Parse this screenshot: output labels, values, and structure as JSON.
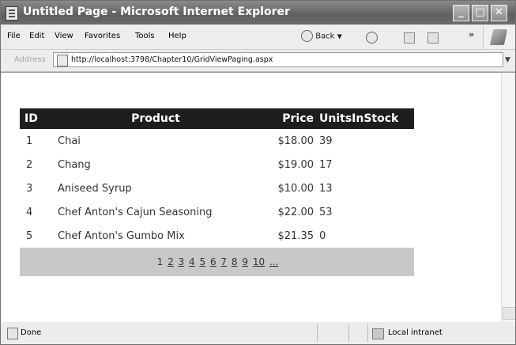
{
  "window": {
    "title": "Untitled Page - Microsoft Internet Explorer"
  },
  "menu": {
    "items": [
      "File",
      "Edit",
      "View",
      "Favorites",
      "Tools",
      "Help"
    ],
    "back_label": "Back"
  },
  "address": {
    "label": "Address",
    "url": "http://localhost:3798/Chapter10/GridViewPaging.aspx"
  },
  "grid": {
    "columns": [
      "ID",
      "Product",
      "Price",
      "UnitsInStock"
    ],
    "rows": [
      {
        "id": "1",
        "product": "Chai",
        "price": "$18.00",
        "units": "39"
      },
      {
        "id": "2",
        "product": "Chang",
        "price": "$19.00",
        "units": "17"
      },
      {
        "id": "3",
        "product": "Aniseed Syrup",
        "price": "$10.00",
        "units": "13"
      },
      {
        "id": "4",
        "product": "Chef Anton's Cajun Seasoning",
        "price": "$22.00",
        "units": "53"
      },
      {
        "id": "5",
        "product": "Chef Anton's Gumbo Mix",
        "price": "$21.35",
        "units": "0"
      }
    ],
    "pager": [
      "1",
      "2",
      "3",
      "4",
      "5",
      "6",
      "7",
      "8",
      "9",
      "10",
      "..."
    ]
  },
  "status": {
    "text": "Done",
    "zone": "Local intranet"
  }
}
